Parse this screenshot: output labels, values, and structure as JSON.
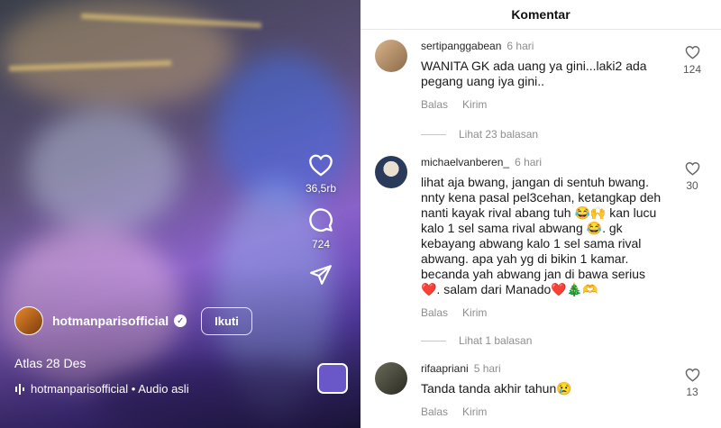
{
  "video": {
    "likes": "36,5rb",
    "comments_count": "724",
    "author": "hotmanparisofficial",
    "follow_label": "Ikuti",
    "caption": "Atlas 28 Des",
    "audio": "hotmanparisofficial • Audio asli"
  },
  "panel": {
    "title": "Komentar"
  },
  "comments": [
    {
      "user": "sertipanggabean",
      "time": "6 hari",
      "text": "WANITA GK ada uang ya gini...laki2 ada pegang uang iya gini..",
      "reply_label": "Balas",
      "send_label": "Kirim",
      "likes": "124",
      "replies_label": "Lihat 23 balasan"
    },
    {
      "user": "michaelvanberen_",
      "time": "6 hari",
      "text": "lihat aja bwang, jangan di sentuh bwang. nnty kena pasal pel3cehan, ketangkap deh nanti kayak rival abang tuh 😂🙌 kan lucu kalo 1 sel sama rival abwang 😂. gk kebayang abwang kalo 1 sel sama rival abwang. apa yah yg di bikin 1 kamar. becanda yah abwang jan di bawa serius❤️. salam dari Manado❤️🎄🫶",
      "reply_label": "Balas",
      "send_label": "Kirim",
      "likes": "30",
      "replies_label": "Lihat 1 balasan"
    },
    {
      "user": "rifaapriani",
      "time": "5 hari",
      "text": "Tanda tanda akhir tahun😢",
      "reply_label": "Balas",
      "send_label": "Kirim",
      "likes": "13"
    }
  ],
  "colors": {
    "accent_button": "#6a58c8",
    "muted_text": "#8e8e8e"
  },
  "icons": [
    "heart-icon",
    "comment-bubble-icon",
    "share-send-icon",
    "verified-badge-icon",
    "audio-wave-icon"
  ]
}
